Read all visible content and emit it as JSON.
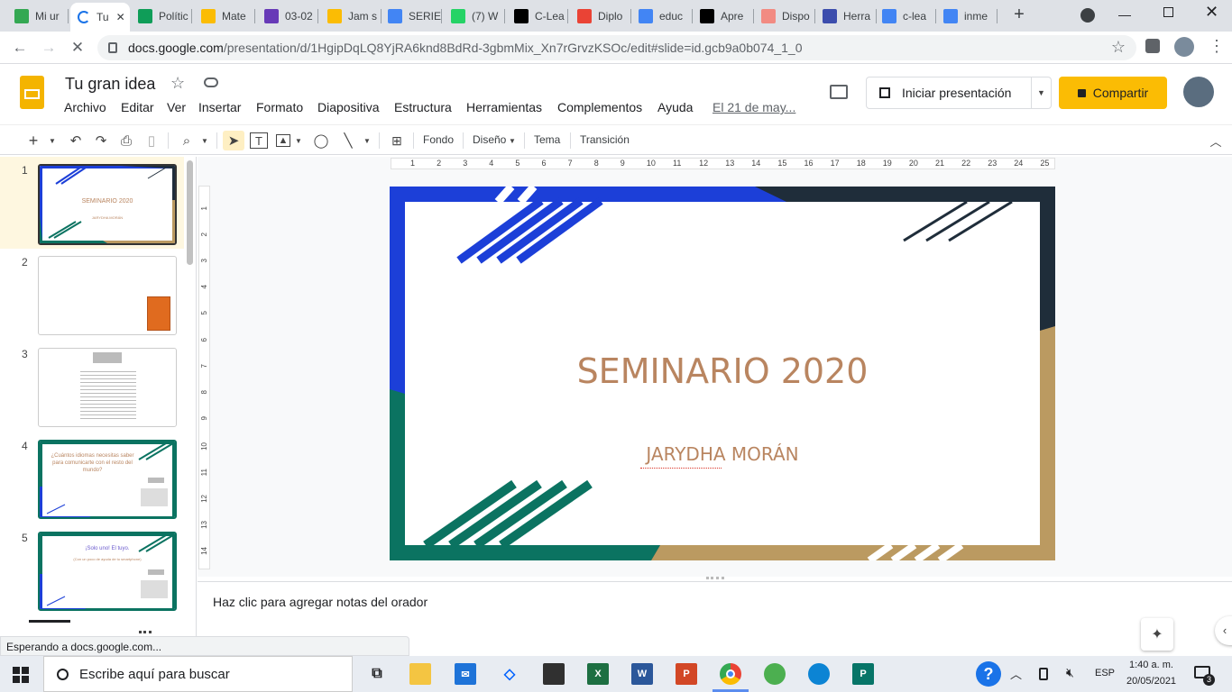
{
  "browser": {
    "tabs": [
      {
        "label": "Mi ur",
        "icon": "google-drive-icon",
        "color": "#34a853"
      },
      {
        "label": "Tu",
        "icon": "loading-icon",
        "color": "#1a73e8",
        "active": true
      },
      {
        "label": "Polític",
        "icon": "google-sheets-icon",
        "color": "#0f9d58"
      },
      {
        "label": "Mate",
        "icon": "google-keep-icon",
        "color": "#fbbc04"
      },
      {
        "label": "03-02",
        "icon": "google-forms-icon",
        "color": "#673ab7"
      },
      {
        "label": "Jam s",
        "icon": "google-keep-icon",
        "color": "#fbbc04"
      },
      {
        "label": "SERIE",
        "icon": "google-docs-icon",
        "color": "#4285f4"
      },
      {
        "label": "(7) W",
        "icon": "whatsapp-icon",
        "color": "#25d366"
      },
      {
        "label": "C-Lea",
        "icon": "wix-icon",
        "color": "#000000"
      },
      {
        "label": "Diplo",
        "icon": "gmail-icon",
        "color": "#ea4335"
      },
      {
        "label": "educ",
        "icon": "google-icon",
        "color": "#4285f4"
      },
      {
        "label": "Apre",
        "icon": "wikipedia-icon",
        "color": "#000000"
      },
      {
        "label": "Dispo",
        "icon": "image-icon",
        "color": "#f28b82"
      },
      {
        "label": "Herra",
        "icon": "globe-icon",
        "color": "#3c4dad"
      },
      {
        "label": "c-lea",
        "icon": "google-icon",
        "color": "#4285f4"
      },
      {
        "label": "inme",
        "icon": "google-icon",
        "color": "#4285f4"
      }
    ],
    "new_tab": "+",
    "url_host": "docs.google.com",
    "url_path": "/presentation/d/1HgipDqLQ8YjRA6knd8BdRd-3gbmMix_Xn7rGrvzKSOc/edit#slide=id.gcb9a0b074_1_0"
  },
  "docs": {
    "title": "Tu gran idea",
    "menu": [
      "Archivo",
      "Editar",
      "Ver",
      "Insertar",
      "Formato",
      "Diapositiva",
      "Estructura",
      "Herramientas",
      "Complementos",
      "Ayuda"
    ],
    "last_edit": "El 21 de may...",
    "present_label": "Iniciar presentación",
    "share_label": "Compartir",
    "share_color": "#fbbc04"
  },
  "toolbar": {
    "fondo": "Fondo",
    "diseno": "Diseño",
    "tema": "Tema",
    "transicion": "Transición"
  },
  "ruler": [
    "1",
    "2",
    "3",
    "4",
    "5",
    "6",
    "7",
    "8",
    "9",
    "10",
    "11",
    "12",
    "13",
    "14",
    "15",
    "16",
    "17",
    "18",
    "19",
    "20",
    "21",
    "22",
    "23",
    "24",
    "25"
  ],
  "vruler": [
    "1",
    "2",
    "3",
    "4",
    "5",
    "6",
    "7",
    "8",
    "9",
    "10",
    "11",
    "12",
    "13",
    "14"
  ],
  "filmstrip": {
    "numbers": [
      "1",
      "2",
      "3",
      "4",
      "5"
    ],
    "slide1_title": "SEMINARIO 2020",
    "slide1_sub": "JARYDHA MORÁN",
    "slide4_title": "¿Cuántos idiomas necesitas saber para comunicarte con el resto del mundo?",
    "slide5_title": "¡Solo uno! El tuyo.",
    "slide5_sub": "(Con un poco de ayuda de tu smartphone)"
  },
  "slide": {
    "title": "SEMINARIO 2020",
    "subtitle": "JARYDHA MORÁN",
    "title_color": "#b98560",
    "blue": "#1c3fd8",
    "dark": "#1f2d3a",
    "green": "#0b7361",
    "gold": "#bb9a61"
  },
  "notes_placeholder": "Haz clic para agregar notas del orador",
  "status_text": "Esperando a docs.google.com...",
  "taskbar": {
    "search_placeholder": "Escribe aquí para buscar",
    "lang": "ESP",
    "time": "1:40 a. m.",
    "date": "20/05/2021",
    "notif_count": "3"
  }
}
